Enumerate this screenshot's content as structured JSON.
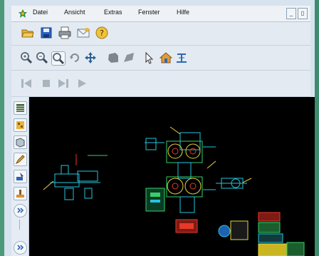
{
  "menu": {
    "items": [
      "Datei",
      "Ansicht",
      "Extras",
      "Fenster",
      "Hilfe"
    ]
  },
  "window_controls": {
    "minimize": "_",
    "maximize": "▯"
  },
  "icons": {
    "file_toolbar": [
      "open-folder-icon",
      "save-icon",
      "print-icon",
      "email-icon",
      "help-icon"
    ],
    "view_toolbar": [
      "zoom-in-icon",
      "zoom-out-icon",
      "zoom-window-icon",
      "rotate-icon",
      "pan-icon",
      "solid-view-icon",
      "shaded-view-icon",
      "select-pointer-icon",
      "home-view-icon",
      "section-icon"
    ],
    "playback_toolbar": [
      "first-frame-icon",
      "stop-icon",
      "next-frame-icon",
      "play-icon"
    ],
    "sidebar": [
      "layers-icon",
      "properties-icon",
      "model-tree-icon",
      "measure-pencil-icon",
      "markup-icon",
      "stamp-icon",
      "expand-icon",
      "expand-icon-2"
    ]
  },
  "colors": {
    "canvas_bg": "#000000",
    "accent": "#4d9a7a",
    "cad_cyan": "#22c6e0",
    "cad_green": "#35d06a",
    "cad_yellow": "#e7d43a",
    "cad_red": "#e53a2a"
  }
}
